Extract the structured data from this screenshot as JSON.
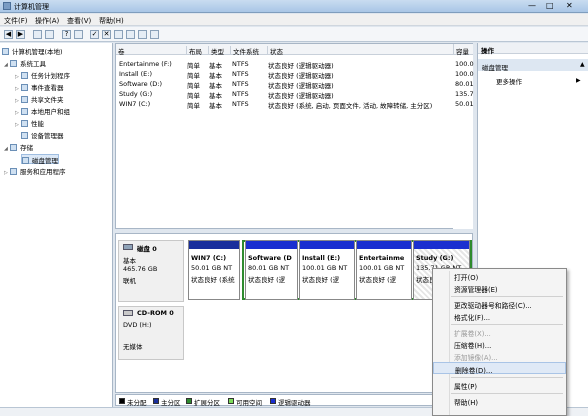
{
  "window": {
    "title": "计算机管理",
    "min": "—",
    "max": "□",
    "close": "✕"
  },
  "menu": [
    "文件(F)",
    "操作(A)",
    "查看(V)",
    "帮助(H)"
  ],
  "tree": {
    "root": "计算机管理(本地)",
    "items": [
      {
        "label": "系统工具",
        "level": 1
      },
      {
        "label": "任务计划程序",
        "level": 2
      },
      {
        "label": "事件查看器",
        "level": 2
      },
      {
        "label": "共享文件夹",
        "level": 2
      },
      {
        "label": "本地用户和组",
        "level": 2
      },
      {
        "label": "性能",
        "level": 2
      },
      {
        "label": "设备管理器",
        "level": 2
      },
      {
        "label": "存储",
        "level": 1
      },
      {
        "label": "磁盘管理",
        "level": 2
      },
      {
        "label": "服务和应用程序",
        "level": 1
      }
    ]
  },
  "volumes": {
    "headers": [
      "卷",
      "布局",
      "类型",
      "文件系统",
      "状态",
      "容量"
    ],
    "rows": [
      {
        "vol": "Entertainme (F:)",
        "layout": "简单",
        "type": "基本",
        "fs": "NTFS",
        "status": "状态良好 (逻辑驱动器)",
        "cap": "100.0"
      },
      {
        "vol": "Install (E:)",
        "layout": "简单",
        "type": "基本",
        "fs": "NTFS",
        "status": "状态良好 (逻辑驱动器)",
        "cap": "100.0"
      },
      {
        "vol": "Software (D:)",
        "layout": "简单",
        "type": "基本",
        "fs": "NTFS",
        "status": "状态良好 (逻辑驱动器)",
        "cap": "80.01"
      },
      {
        "vol": "Study (G:)",
        "layout": "简单",
        "type": "基本",
        "fs": "NTFS",
        "status": "状态良好 (逻辑驱动器)",
        "cap": "135.7"
      },
      {
        "vol": "WIN7 (C:)",
        "layout": "简单",
        "type": "基本",
        "fs": "NTFS",
        "status": "状态良好 (系统, 启动, 页面文件, 活动, 故障转储, 主分区)",
        "cap": "50.01"
      }
    ]
  },
  "actions": {
    "header": "操作",
    "section": "磁盘管理",
    "more": "更多操作"
  },
  "disk0": {
    "name": "磁盘 0",
    "kind": "基本",
    "size": "465.76 GB",
    "state": "联机",
    "parts": [
      {
        "name": "WIN7 (C:)",
        "size": "50.01 GB NT",
        "status": "状态良好 (系统"
      },
      {
        "name": "Software (D",
        "size": "80.01 GB NT",
        "status": "状态良好 (逻"
      },
      {
        "name": "Install (E:)",
        "size": "100.01 GB NT",
        "status": "状态良好 (逻"
      },
      {
        "name": "Entertainme",
        "size": "100.01 GB NT",
        "status": "状态良好 (逻"
      },
      {
        "name": "Study (G:)",
        "size": "135.71 GB NT",
        "status": "状态良好 (逻"
      }
    ]
  },
  "cdrom": {
    "name": "CD-ROM 0",
    "drive": "DVD (H:)",
    "media": "无媒体"
  },
  "legend": [
    "未分配",
    "主分区",
    "扩展分区",
    "可用空间",
    "逻辑驱动器"
  ],
  "colors": {
    "unalloc": "#000000",
    "primary": "#1a2f9c",
    "extended": "#2e8b2e",
    "free": "#7ddc5a",
    "logical": "#1a2fd0"
  },
  "context_menu": [
    {
      "label": "打开(O)",
      "disabled": false
    },
    {
      "label": "资源管理器(E)",
      "disabled": false
    },
    {
      "sep": true
    },
    {
      "label": "更改驱动器号和路径(C)...",
      "disabled": false
    },
    {
      "label": "格式化(F)...",
      "disabled": false
    },
    {
      "sep": true
    },
    {
      "label": "扩展卷(X)...",
      "disabled": true
    },
    {
      "label": "压缩卷(H)...",
      "disabled": false
    },
    {
      "label": "添加镜像(A)...",
      "disabled": true
    },
    {
      "label": "删除卷(D)...",
      "disabled": false,
      "highlight": true
    },
    {
      "sep": true
    },
    {
      "label": "属性(P)",
      "disabled": false
    },
    {
      "sep": true
    },
    {
      "label": "帮助(H)",
      "disabled": false
    }
  ]
}
